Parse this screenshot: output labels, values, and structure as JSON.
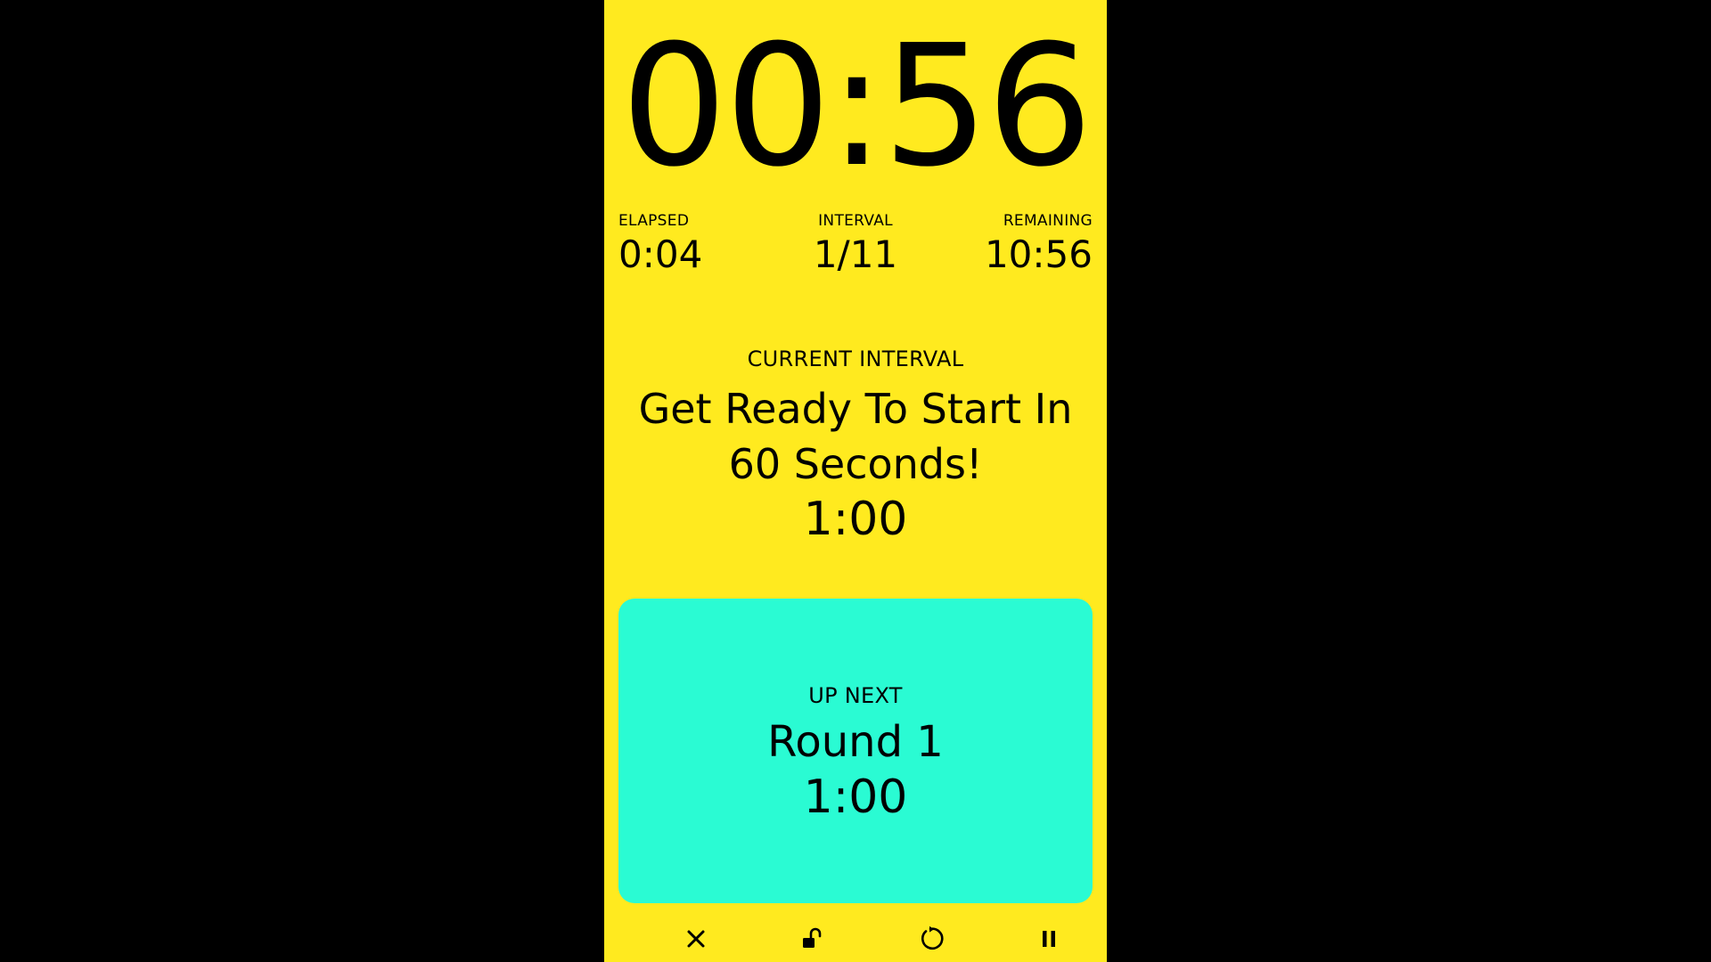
{
  "timer": {
    "main": "00:56"
  },
  "stats": {
    "elapsed_label": "ELAPSED",
    "elapsed_value": "0:04",
    "interval_label": "INTERVAL",
    "interval_value": "1/11",
    "remaining_label": "REMAINING",
    "remaining_value": "10:56"
  },
  "current_interval": {
    "label": "CURRENT INTERVAL",
    "name": "Get Ready To Start In 60 Seconds!",
    "duration": "1:00"
  },
  "up_next": {
    "label": "UP NEXT",
    "name": "Round 1",
    "duration": "1:00"
  },
  "controls": [
    {
      "icon": "close-icon"
    },
    {
      "icon": "unlock-icon"
    },
    {
      "icon": "restart-icon"
    },
    {
      "icon": "pause-icon"
    }
  ],
  "colors": {
    "background": "#FFEA1F",
    "next_card": "#2AFBD3",
    "letterbox": "#000000",
    "text": "#000000"
  }
}
